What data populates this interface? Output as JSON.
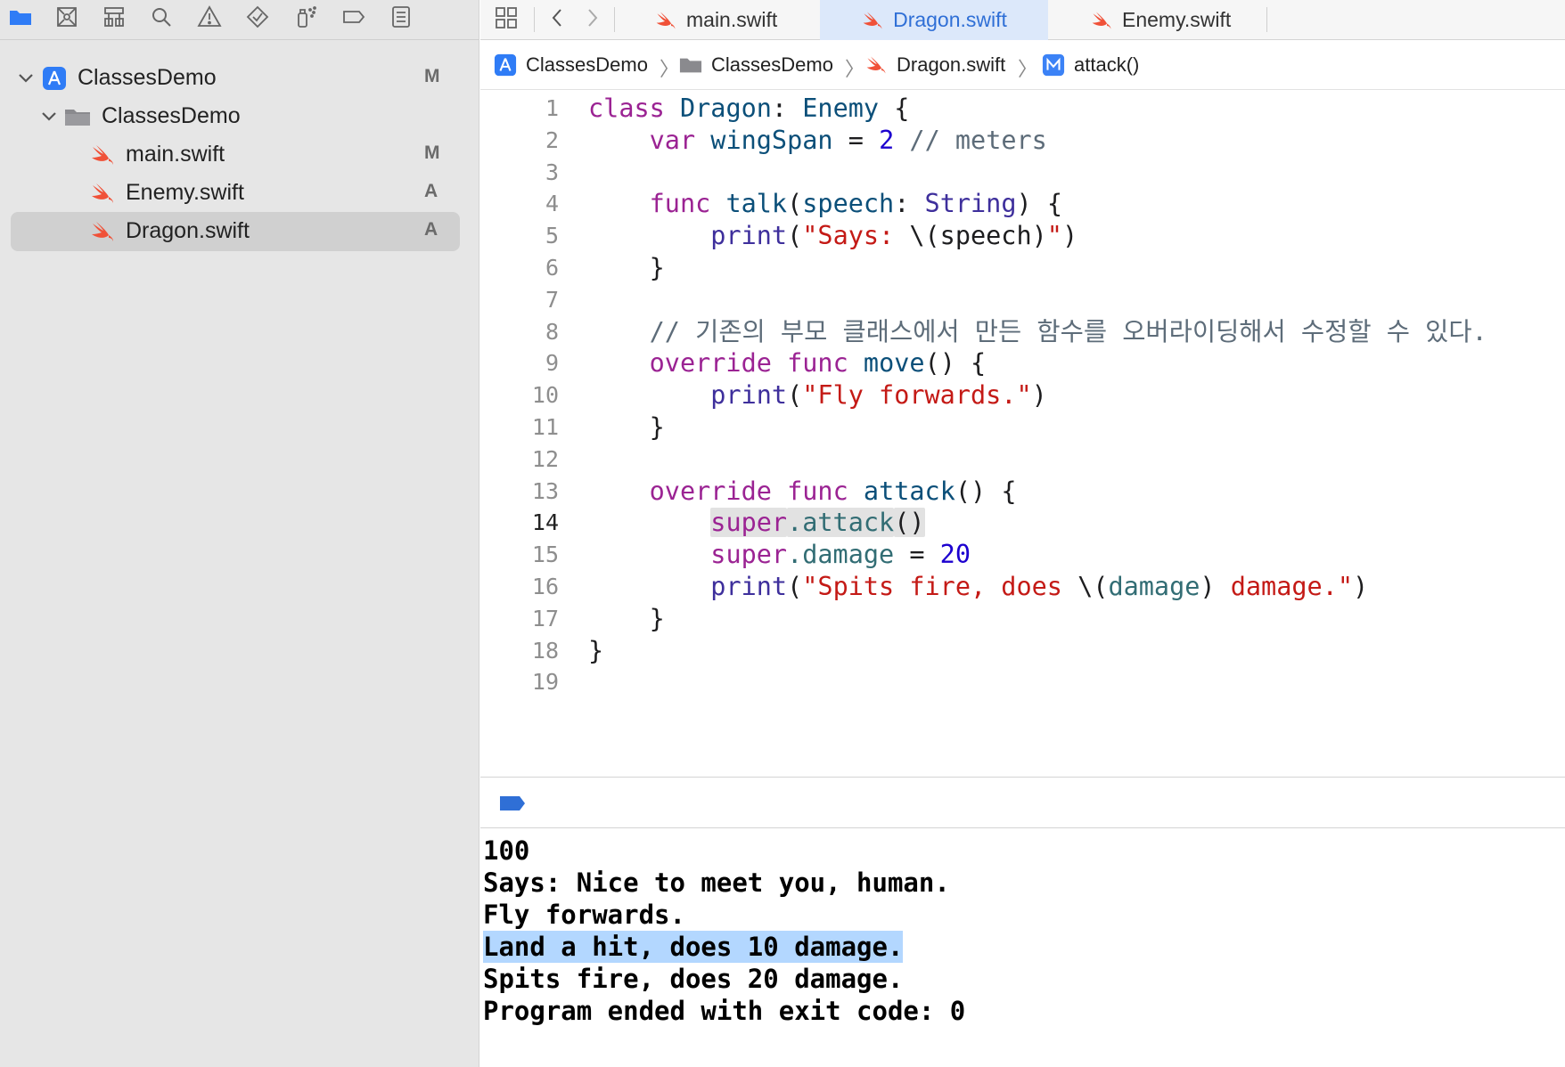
{
  "colors": {
    "accent": "#2f6fd6",
    "swift_orange": "#f05138",
    "sidebar_bg": "#e6e6e6",
    "selection": "#d0d0d0",
    "console_selection": "#b3d7ff"
  },
  "navigator": {
    "toolbar_icons": [
      "folder-icon",
      "source-control-icon",
      "symbol-hierarchy-icon",
      "search-icon",
      "warning-icon",
      "test-diamond-icon",
      "debug-spray-icon",
      "breakpoint-tag-icon",
      "report-list-icon"
    ],
    "tree": [
      {
        "label": "ClassesDemo",
        "badge": "M",
        "icon": "xcode-project-icon",
        "level": 0,
        "expanded": true
      },
      {
        "label": "ClassesDemo",
        "badge": "",
        "icon": "folder-icon",
        "level": 1,
        "expanded": true
      },
      {
        "label": "main.swift",
        "badge": "M",
        "icon": "swift-file-icon",
        "level": 2
      },
      {
        "label": "Enemy.swift",
        "badge": "A",
        "icon": "swift-file-icon",
        "level": 2
      },
      {
        "label": "Dragon.swift",
        "badge": "A",
        "icon": "swift-file-icon",
        "level": 2,
        "selected": true
      }
    ]
  },
  "tabs": [
    {
      "label": "main.swift",
      "active": false
    },
    {
      "label": "Dragon.swift",
      "active": true
    },
    {
      "label": "Enemy.swift",
      "active": false
    }
  ],
  "breadcrumb": [
    {
      "label": "ClassesDemo",
      "icon": "xcode-project-icon"
    },
    {
      "label": "ClassesDemo",
      "icon": "folder-icon"
    },
    {
      "label": "Dragon.swift",
      "icon": "swift-file-icon"
    },
    {
      "label": "attack()",
      "icon": "method-m-icon"
    }
  ],
  "editor": {
    "current_line": 14,
    "lines": [
      {
        "n": "1",
        "t": [
          [
            "kw",
            "class"
          ],
          [
            "plain",
            " "
          ],
          [
            "cls",
            "Dragon"
          ],
          [
            "plain",
            ": "
          ],
          [
            "cls",
            "Enemy"
          ],
          [
            "plain",
            " {"
          ]
        ]
      },
      {
        "n": "2",
        "t": [
          [
            "plain",
            "    "
          ],
          [
            "kw",
            "var"
          ],
          [
            "plain",
            " "
          ],
          [
            "cls",
            "wingSpan"
          ],
          [
            "plain",
            " = "
          ],
          [
            "num",
            "2"
          ],
          [
            "plain",
            " "
          ],
          [
            "cmt",
            "// meters"
          ]
        ]
      },
      {
        "n": "3",
        "t": []
      },
      {
        "n": "4",
        "t": [
          [
            "plain",
            "    "
          ],
          [
            "kw",
            "func"
          ],
          [
            "plain",
            " "
          ],
          [
            "cls",
            "talk"
          ],
          [
            "plain",
            "("
          ],
          [
            "cls",
            "speech"
          ],
          [
            "plain",
            ": "
          ],
          [
            "ty",
            "String"
          ],
          [
            "plain",
            ") {"
          ]
        ]
      },
      {
        "n": "5",
        "t": [
          [
            "plain",
            "        "
          ],
          [
            "ty",
            "print"
          ],
          [
            "plain",
            "("
          ],
          [
            "str",
            "\"Says: "
          ],
          [
            "plain",
            "\\(speech)"
          ],
          [
            "str",
            "\""
          ],
          [
            "plain",
            ")"
          ]
        ]
      },
      {
        "n": "6",
        "t": [
          [
            "plain",
            "    }"
          ]
        ]
      },
      {
        "n": "7",
        "t": []
      },
      {
        "n": "8",
        "t": [
          [
            "plain",
            "    "
          ],
          [
            "cmt",
            "// 기존의 부모 클래스에서 만든 함수를 오버라이딩해서 수정할 수 있다."
          ]
        ]
      },
      {
        "n": "9",
        "t": [
          [
            "plain",
            "    "
          ],
          [
            "kw",
            "override"
          ],
          [
            "plain",
            " "
          ],
          [
            "kw",
            "func"
          ],
          [
            "plain",
            " "
          ],
          [
            "cls",
            "move"
          ],
          [
            "plain",
            "() {"
          ]
        ]
      },
      {
        "n": "10",
        "t": [
          [
            "plain",
            "        "
          ],
          [
            "ty",
            "print"
          ],
          [
            "plain",
            "("
          ],
          [
            "str",
            "\"Fly forwards.\""
          ],
          [
            "plain",
            ")"
          ]
        ]
      },
      {
        "n": "11",
        "t": [
          [
            "plain",
            "    }"
          ]
        ]
      },
      {
        "n": "12",
        "t": []
      },
      {
        "n": "13",
        "t": [
          [
            "plain",
            "    "
          ],
          [
            "kw",
            "override"
          ],
          [
            "plain",
            " "
          ],
          [
            "kw",
            "func"
          ],
          [
            "plain",
            " "
          ],
          [
            "cls",
            "attack"
          ],
          [
            "plain",
            "() {"
          ]
        ]
      },
      {
        "n": "14",
        "t": [
          [
            "plain",
            "        "
          ],
          [
            "kw hl",
            "super"
          ],
          [
            "fn hl",
            ".attack"
          ],
          [
            "plain hl",
            "()"
          ]
        ]
      },
      {
        "n": "15",
        "t": [
          [
            "plain",
            "        "
          ],
          [
            "kw",
            "super"
          ],
          [
            "fn",
            ".damage"
          ],
          [
            "plain",
            " = "
          ],
          [
            "num",
            "20"
          ]
        ]
      },
      {
        "n": "16",
        "t": [
          [
            "plain",
            "        "
          ],
          [
            "ty",
            "print"
          ],
          [
            "plain",
            "("
          ],
          [
            "str",
            "\"Spits fire, does "
          ],
          [
            "plain",
            "\\("
          ],
          [
            "fn",
            "damage"
          ],
          [
            "plain",
            ") "
          ],
          [
            "str",
            "damage.\""
          ],
          [
            "plain",
            ")"
          ]
        ]
      },
      {
        "n": "17",
        "t": [
          [
            "plain",
            "    }"
          ]
        ]
      },
      {
        "n": "18",
        "t": [
          [
            "plain",
            "}"
          ]
        ]
      },
      {
        "n": "19",
        "t": []
      }
    ]
  },
  "console": {
    "selected_index": 3,
    "lines": [
      "100",
      "Says: Nice to meet you, human.",
      "Fly forwards.",
      "Land a hit, does 10 damage.",
      "Spits fire, does 20 damage.",
      "Program ended with exit code: 0"
    ]
  }
}
